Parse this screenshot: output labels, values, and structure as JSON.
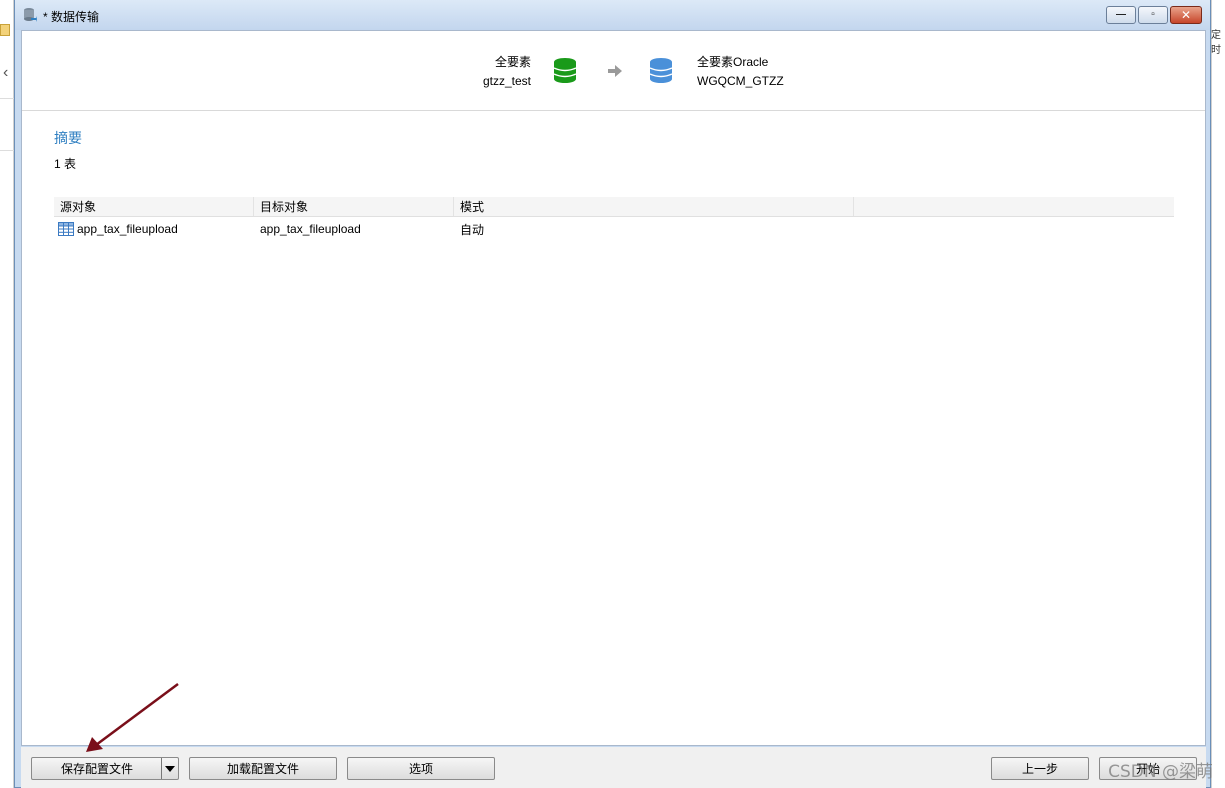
{
  "window": {
    "title": "* 数据传输",
    "buttons": {
      "minimize": "minimize",
      "maximize": "maximize",
      "close": "close"
    }
  },
  "background": {
    "right_edge_text": "定时"
  },
  "transfer": {
    "source": {
      "line1": "全要素",
      "line2": "gtzz_test",
      "color": "#1a9a1a"
    },
    "target": {
      "line1": "全要素Oracle",
      "line2": "WGQCM_GTZZ",
      "color": "#4a90d9"
    }
  },
  "summary": {
    "title": "摘要",
    "count": "1 表"
  },
  "table": {
    "headers": [
      "源对象",
      "目标对象",
      "模式",
      ""
    ],
    "rows": [
      {
        "source": "app_tax_fileupload",
        "target": "app_tax_fileupload",
        "mode": "自动"
      }
    ]
  },
  "footer": {
    "save_profile": "保存配置文件",
    "load_profile": "加载配置文件",
    "options": "选项",
    "prev": "上一步",
    "start": "开始"
  },
  "watermark": "CSDN @梁萌",
  "colors": {
    "accent": "#2f7fc1",
    "annotation_arrow": "#7a0f1a"
  }
}
